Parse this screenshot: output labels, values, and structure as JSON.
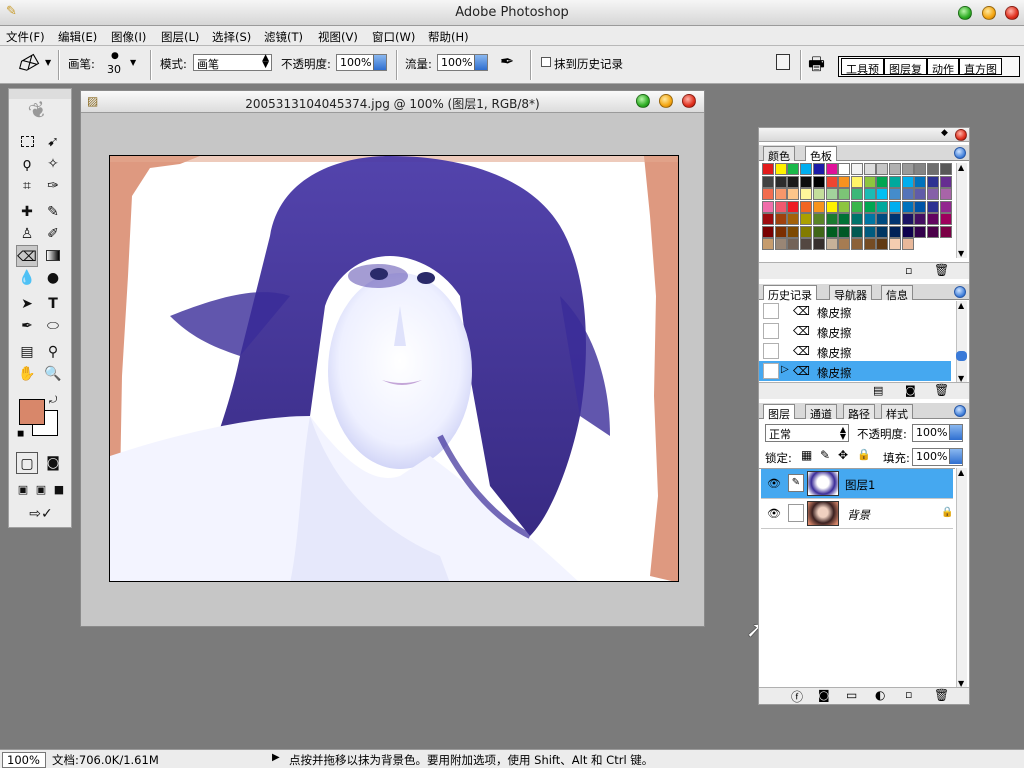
{
  "app": {
    "title": "Adobe Photoshop"
  },
  "menu": [
    "文件(F)",
    "编辑(E)",
    "图像(I)",
    "图层(L)",
    "选择(S)",
    "滤镜(T)",
    "视图(V)",
    "窗口(W)",
    "帮助(H)"
  ],
  "options": {
    "brush_label": "画笔:",
    "brush_size": "30",
    "mode_label": "模式:",
    "mode_value": "画笔",
    "opacity_label": "不透明度:",
    "opacity_value": "100%",
    "flow_label": "流量:",
    "flow_value": "100%",
    "erase_history_label": "抹到历史记录",
    "palette_tabs": [
      "工具预",
      "图层复",
      "动作",
      "直方图"
    ]
  },
  "document": {
    "title": "2005313104045374.jpg @ 100% (图层1, RGB/8*)"
  },
  "swatches": {
    "tabs": [
      "颜色",
      "色板"
    ],
    "colors": [
      "#e21b1b",
      "#fff100",
      "#19b84a",
      "#00aeef",
      "#1b1ba8",
      "#e0119a",
      "#ffffff",
      "#f2f2f2",
      "#dcdcdc",
      "#c6c6c6",
      "#b0b0b0",
      "#9a9a9a",
      "#848484",
      "#6e6e6e",
      "#585858",
      "#424242",
      "#2c2c2c",
      "#1a1a1a",
      "#0d0d0d",
      "#000000",
      "#ef4630",
      "#f6921e",
      "#fff568",
      "#8dc63f",
      "#00a651",
      "#00a99d",
      "#00aeef",
      "#0072bc",
      "#2e3192",
      "#662d91",
      "#f26c4f",
      "#f7976a",
      "#fdc68a",
      "#fff79a",
      "#c4df9b",
      "#a3d39c",
      "#7cc576",
      "#3cb878",
      "#1cbbb4",
      "#00bff3",
      "#448ccb",
      "#5574b9",
      "#605ca8",
      "#8560a8",
      "#a864a8",
      "#f06eaa",
      "#f0596f",
      "#ed1c24",
      "#f26522",
      "#f7941d",
      "#fff200",
      "#8dc63f",
      "#39b54a",
      "#00a651",
      "#00a99d",
      "#00aeef",
      "#0072bc",
      "#0054a6",
      "#2e3192",
      "#92278f",
      "#9e0b0f",
      "#a0410d",
      "#a36209",
      "#aba000",
      "#598527",
      "#1a7b30",
      "#007236",
      "#00746b",
      "#0076a3",
      "#004b80",
      "#003471",
      "#1b1464",
      "#440e62",
      "#630460",
      "#9e005d",
      "#790000",
      "#7b2e00",
      "#7d4900",
      "#827b00",
      "#406618",
      "#005e20",
      "#005826",
      "#005952",
      "#005b7f",
      "#003663",
      "#002157",
      "#0d004c",
      "#32004b",
      "#4b0049",
      "#7b0046",
      "#c69c6d",
      "#998675",
      "#736357",
      "#534741",
      "#362f2d",
      "#c7b299",
      "#a67c52",
      "#8c6239",
      "#754c24",
      "#603913",
      "#f5cdb0",
      "#e8b89a"
    ]
  },
  "history": {
    "tabs": [
      "历史记录",
      "导航器",
      "信息"
    ],
    "items": [
      "橡皮擦",
      "橡皮擦",
      "橡皮擦",
      "橡皮擦"
    ]
  },
  "layers": {
    "tabs": [
      "图层",
      "通道",
      "路径",
      "样式"
    ],
    "blend_mode": "正常",
    "opacity_label": "不透明度:",
    "opacity_value": "100%",
    "lock_label": "锁定:",
    "fill_label": "填充:",
    "fill_value": "100%",
    "items": [
      {
        "name": "图层1",
        "selected": true
      },
      {
        "name": "背景",
        "selected": false
      }
    ]
  },
  "status": {
    "zoom": "100%",
    "doc_size": "文档:706.0K/1.61M",
    "hint": "点按并拖移以抹为背景色。要用附加选项，使用 Shift、Alt 和 Ctrl 键。"
  },
  "colors": {
    "foreground": "#d8876a",
    "background": "#ffffff",
    "selection": "#45a8f0"
  }
}
